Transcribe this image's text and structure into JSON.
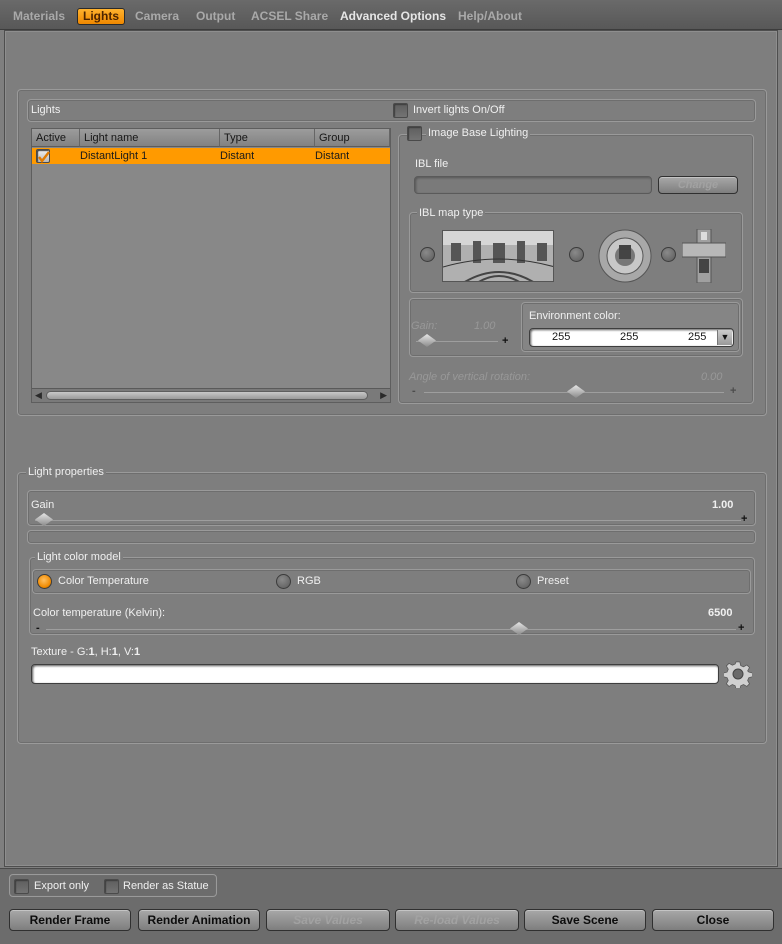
{
  "tabs": [
    {
      "label": "Materials"
    },
    {
      "label": "Lights"
    },
    {
      "label": "Camera"
    },
    {
      "label": "Output"
    },
    {
      "label": "ACSEL Share"
    },
    {
      "label": "Advanced Options"
    },
    {
      "label": "Help/About"
    }
  ],
  "lights_panel": {
    "title": "Lights",
    "invert_label": "Invert lights On/Off",
    "table": {
      "columns": [
        "Active",
        "Light name",
        "Type",
        "Group"
      ],
      "rows": [
        {
          "active": true,
          "name": "DistantLight 1",
          "type": "Distant",
          "group": "Distant"
        }
      ]
    }
  },
  "ibl": {
    "title": "Image Base Lighting",
    "file_label": "IBL file",
    "file_value": "",
    "change_button": "Change",
    "map_type_label": "IBL map type",
    "map_types": [
      "latlong-map",
      "angular-map",
      "cross-map"
    ],
    "gain_label": "Gain:",
    "gain_value": "1.00",
    "env_color_label": "Environment color:",
    "env_color": [
      "255",
      "255",
      "255"
    ],
    "rotation_label": "Angle of vertical rotation:",
    "rotation_value": "0.00"
  },
  "light_properties": {
    "title": "Light properties",
    "gain_label": "Gain",
    "gain_value": "1.00",
    "color_model_label": "Light color model",
    "color_models": [
      {
        "label": "Color Temperature",
        "selected": true
      },
      {
        "label": "RGB",
        "selected": false
      },
      {
        "label": "Preset",
        "selected": false
      }
    ],
    "color_temp_label": "Color temperature (Kelvin):",
    "color_temp_value": "6500",
    "texture_prefix": "Texture - G:",
    "texture_g": "1",
    "texture_h_sep": ", H:",
    "texture_h": "1",
    "texture_v_sep": ", V:",
    "texture_v": "1",
    "texture_value": ""
  },
  "footer": {
    "export_only": "Export only",
    "render_as_statue": "Render as Statue",
    "buttons": {
      "render_frame": "Render Frame",
      "render_animation": "Render Animation",
      "save_values": "Save Values",
      "reload_values": "Re-load Values",
      "save_scene": "Save Scene",
      "close": "Close"
    }
  },
  "colors": {
    "accent": "#ff9a00",
    "panel_bg": "#7e7e7e",
    "tab_bar": "#5e5e5e"
  }
}
